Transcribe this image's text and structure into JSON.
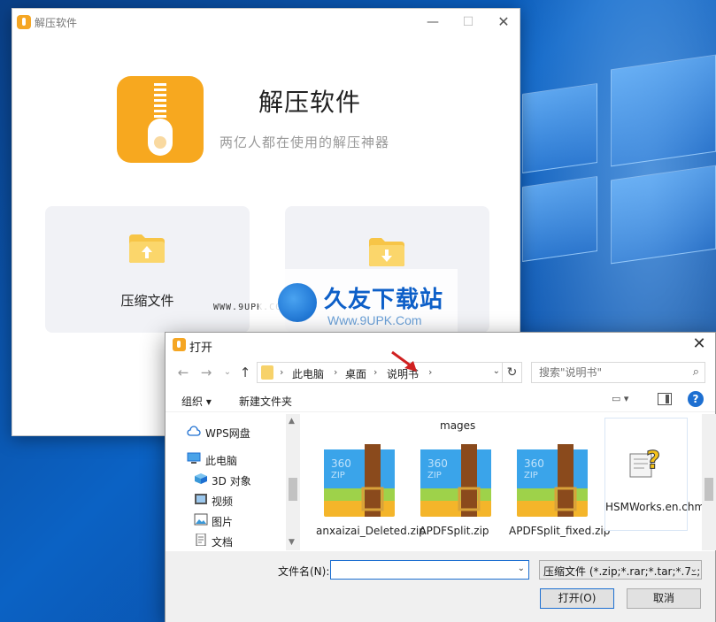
{
  "colors": {
    "accent": "#f7a81f",
    "dialog_focus": "#1d6fd1",
    "card_bg": "#f1f2f6"
  },
  "app": {
    "title": "解压软件",
    "heading": "解压软件",
    "subtitle": "两亿人都在使用的解压神器",
    "window_buttons": {
      "minimize": "—",
      "maximize": "☐",
      "close": "✕"
    },
    "cards": [
      {
        "label": "压缩文件",
        "icon": "folder-upload-icon"
      },
      {
        "label": "",
        "icon": "folder-download-icon"
      }
    ]
  },
  "watermark": {
    "title": "久友下载站",
    "url": "Www.9UPK.Com",
    "url_left": "WWW.9UPK.COM"
  },
  "dialog": {
    "title": "打开",
    "close": "✕",
    "breadcrumb": [
      "此电脑",
      "桌面",
      "说明书"
    ],
    "search_placeholder": "搜索\"说明书\"",
    "toolbar": {
      "organize": "组织 ▾",
      "new_folder": "新建文件夹"
    },
    "nav_items": [
      {
        "label": "WPS网盘",
        "icon": "cloud-icon"
      },
      {
        "label": "此电脑",
        "icon": "computer-icon"
      },
      {
        "label": "3D 对象",
        "icon": "cube-icon"
      },
      {
        "label": "视频",
        "icon": "video-icon"
      },
      {
        "label": "图片",
        "icon": "picture-icon"
      },
      {
        "label": "文档",
        "icon": "document-icon"
      }
    ],
    "partial_file_label": "mages",
    "files": [
      {
        "label": "anxaizai_Deleted.zip",
        "icon": "zip-archive-icon"
      },
      {
        "label": "APDFSplit.zip",
        "icon": "zip-archive-icon"
      },
      {
        "label": "APDFSplit_fixed.zip",
        "icon": "zip-archive-icon"
      },
      {
        "label": "HSMWorks.en.chm",
        "icon": "chm-help-icon"
      }
    ],
    "filename_label": "文件名(N):",
    "filename_value": "",
    "filetype": "压缩文件 (*.zip;*.rar;*.tar;*.7z;",
    "open_button": "打开(O)",
    "cancel_button": "取消"
  }
}
